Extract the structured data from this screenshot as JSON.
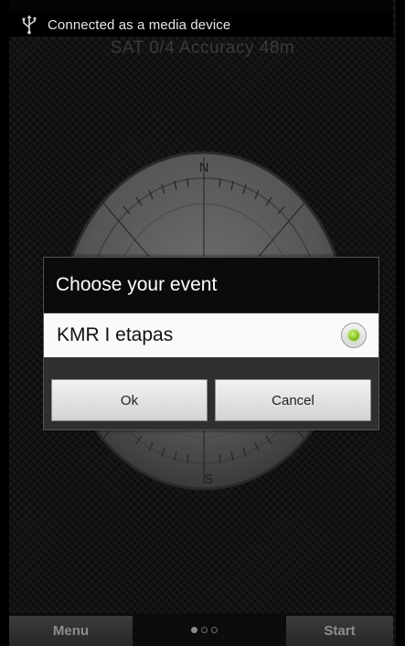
{
  "status_bar": {
    "icon": "usb-icon",
    "notification": "Connected as a media device"
  },
  "gps_info": "SAT 0/4 Accuracy 48m",
  "compass": {
    "north": "N",
    "south": "S"
  },
  "dialog": {
    "title": "Choose your event",
    "items": [
      {
        "label": "KMR I etapas",
        "selected": true
      }
    ],
    "ok_label": "Ok",
    "cancel_label": "Cancel"
  },
  "bottom_bar": {
    "menu_label": "Menu",
    "start_label": "Start",
    "pages": 3,
    "active_page": 1
  },
  "colors": {
    "radio_selected": "#8bc424",
    "dialog_title_bg": "#0b0b0b",
    "dialog_item_bg": "#fafafa"
  }
}
